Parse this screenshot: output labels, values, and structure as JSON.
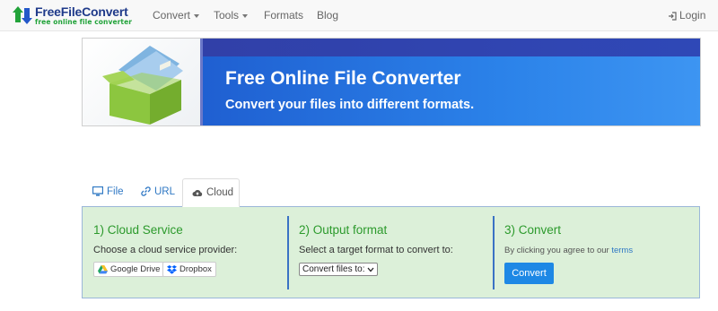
{
  "brand": {
    "name": "FreeFileConvert",
    "tagline": "free online file converter"
  },
  "nav": {
    "items": [
      {
        "label": "Convert",
        "has_caret": true
      },
      {
        "label": "Tools",
        "has_caret": true
      },
      {
        "label": "Formats",
        "has_caret": false
      },
      {
        "label": "Blog",
        "has_caret": false
      }
    ],
    "login_label": "Login"
  },
  "banner": {
    "title": "Free Online File Converter",
    "subtitle": "Convert your files into different formats."
  },
  "tabs": [
    {
      "label": "File",
      "icon": "monitor-icon",
      "active": false
    },
    {
      "label": "URL",
      "icon": "link-icon",
      "active": false
    },
    {
      "label": "Cloud",
      "icon": "cloud-icon",
      "active": true
    }
  ],
  "steps": {
    "cloud": {
      "title": "1) Cloud Service",
      "text": "Choose a cloud service provider:",
      "providers": [
        {
          "label": "Google Drive",
          "icon": "google-drive-icon"
        },
        {
          "label": "Dropbox",
          "icon": "dropbox-icon"
        }
      ]
    },
    "output": {
      "title": "2) Output format",
      "text": "Select a target format to convert to:",
      "select_value": "Convert files to:"
    },
    "convert": {
      "title": "3) Convert",
      "terms_prefix": "By clicking you agree to our ",
      "terms_link": "terms",
      "button_label": "Convert"
    }
  },
  "colors": {
    "accent_blue": "#1e88e5",
    "step_green": "#2c9a2c",
    "panel_bg": "#dcf0d9",
    "banner_blue": "#2b82e9"
  }
}
